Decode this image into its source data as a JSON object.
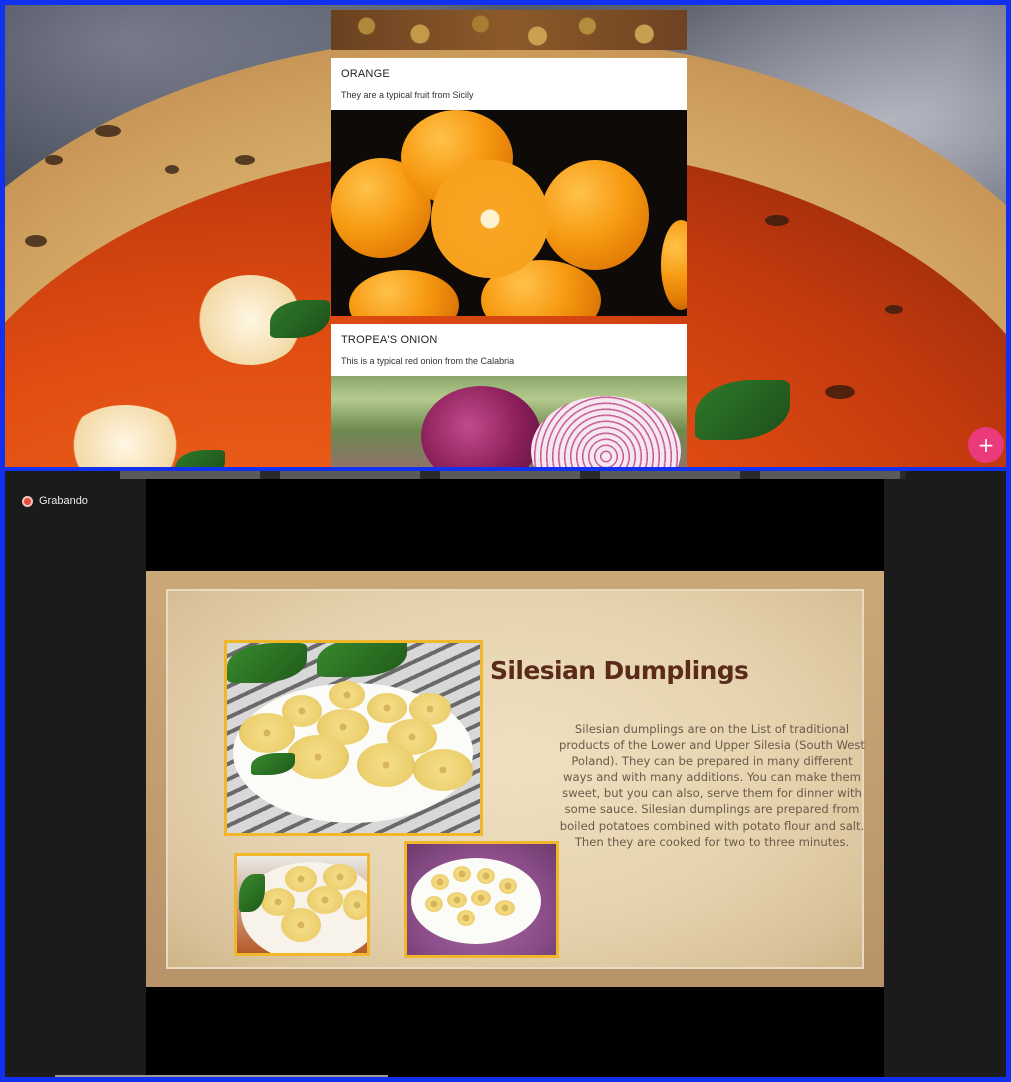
{
  "board": {
    "posts": [
      {
        "title": "ORANGE",
        "body": "They are a typical fruit from Sicily",
        "image": "oranges-photo"
      },
      {
        "title": "TROPEA'S ONION",
        "body": "This is a typical red onion from the Calabria",
        "image": "red-onion-photo"
      }
    ],
    "fab_label": "+",
    "background_image": "pizza-photo"
  },
  "meeting": {
    "recording_label": "Grabando",
    "recording_color": "#e74c3c"
  },
  "slide": {
    "title": "Silesian Dumplings",
    "text": "Silesian dumplings are on the List of traditional products of the Lower and Upper Silesia (South West Poland). They can be prepared in many different ways and with many additions. You can make them sweet, but you can also, serve them for dinner with some sauce. Silesian dumplings are prepared from boiled potatoes combined with potato flour and salt. Then they are cooked for two to three minutes.",
    "images": [
      "dumplings-plate-photo",
      "dumplings-sauce-photo",
      "dumplings-bacon-photo"
    ],
    "title_color": "#5a2a1a",
    "frame_color": "#f1b72b"
  },
  "colors": {
    "frame_blue": "#1230f0",
    "fab_pink": "#ea3a7a"
  }
}
